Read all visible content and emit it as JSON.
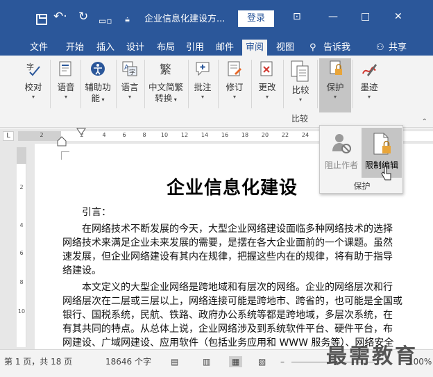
{
  "titlebar": {
    "doc_title": "企业信息化建设方...",
    "login_label": "登录",
    "minimize": "—",
    "maximize": "□",
    "close": "✕"
  },
  "tabs": [
    {
      "label": "文件"
    },
    {
      "label": "开始"
    },
    {
      "label": "插入"
    },
    {
      "label": "设计"
    },
    {
      "label": "布局"
    },
    {
      "label": "引用"
    },
    {
      "label": "邮件"
    },
    {
      "label": "审阅"
    },
    {
      "label": "视图"
    },
    {
      "label": "告诉我"
    },
    {
      "label": "共享"
    }
  ],
  "ribbon": {
    "buttons": [
      {
        "label": "校对",
        "icon": "proofing-icon"
      },
      {
        "label": "语音",
        "icon": "speech-icon"
      },
      {
        "label": "辅助功",
        "label2": "能",
        "icon": "accessibility-icon"
      },
      {
        "label": "语言",
        "icon": "language-icon"
      },
      {
        "label": "中文简繁",
        "label2": "转换",
        "icon": "chinese-conversion-icon"
      },
      {
        "label": "批注",
        "icon": "comment-icon"
      },
      {
        "label": "修订",
        "icon": "track-changes-icon"
      },
      {
        "label": "更改",
        "icon": "changes-icon"
      },
      {
        "label": "比较",
        "icon": "compare-icon"
      },
      {
        "label": "保护",
        "icon": "protect-icon"
      },
      {
        "label": "墨迹",
        "icon": "ink-icon"
      }
    ],
    "compare_group_label": "比较"
  },
  "popup": {
    "block_authors": "阻止作者",
    "restrict_editing": "限制编辑",
    "group_label": "保护"
  },
  "ruler": {
    "corner": "L",
    "h_ticks": [
      "2",
      "2",
      "4",
      "6",
      "8",
      "10",
      "12",
      "14",
      "16",
      "18",
      "20",
      "22",
      "24"
    ],
    "v_ticks": [
      "2",
      "4",
      "6",
      "8",
      "10"
    ]
  },
  "document": {
    "heading": "企业信息化建设",
    "lines": [
      "引言：",
      "在网络技术不断发展的今天，大型企业网络建设面临多种网络技术的选择",
      "网络技术来满足企业未来发展的需要，是摆在各大企业面前的一个课题。虽然",
      "速发展，但企业网络建设有其内在规律，把握这些内在的规律，将有助于指导",
      "络建设。",
      "本文定义的大型企业网络是跨地域和有层次的网络。企业的网络层次和行",
      "网络层次在二层或三层以上，网络连接可能是跨地市、跨省的，也可能是全国或",
      "银行、国税系统，民航、铁路、政府办公系统等都是跨地域，多层次系统，在",
      "有其共同的特点。从总体上说，企业网络涉及到系统软件平台、硬件平台，布",
      "网建设、广域网建设、应用软件（包括业务应用和 WWW 服务等）、网络安全"
    ]
  },
  "statusbar": {
    "page": "第 1 页，共 18 页",
    "words": "18646 个字",
    "zoom": "100%"
  },
  "watermark": "最需教育"
}
